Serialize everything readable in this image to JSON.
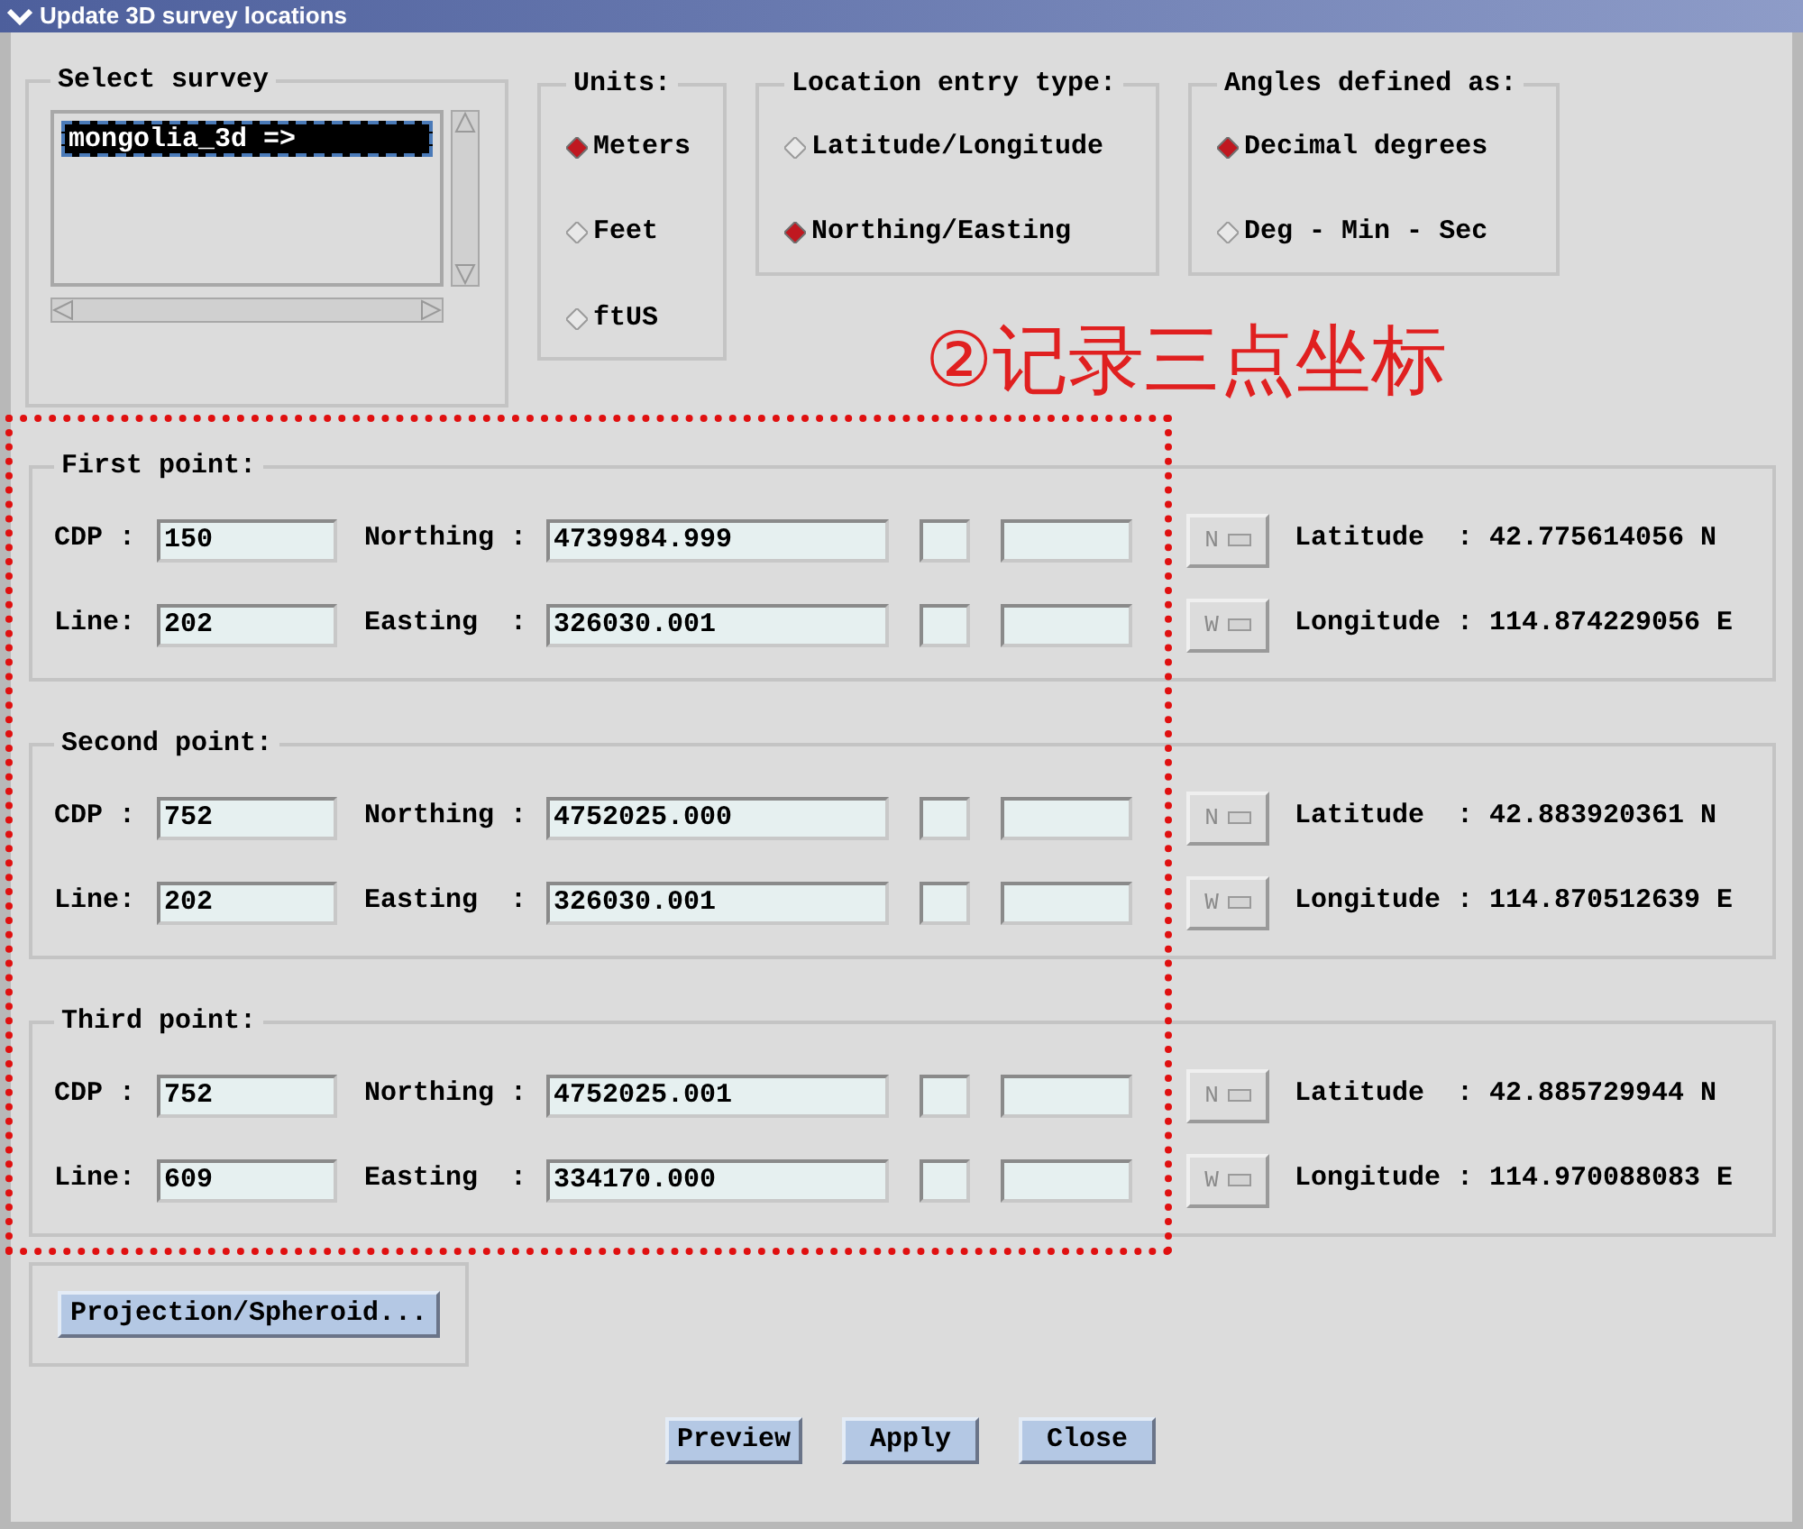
{
  "window": {
    "title": "Update 3D survey locations"
  },
  "survey": {
    "title": "Select survey",
    "items": [
      {
        "label": "mongolia_3d =>",
        "selected": true
      }
    ]
  },
  "radio_groups": [
    {
      "title": "Units:",
      "options": [
        {
          "label": "Meters",
          "selected": true
        },
        {
          "label": "Feet",
          "selected": false
        },
        {
          "label": "ftUS",
          "selected": false
        }
      ]
    },
    {
      "title": "Location entry type:",
      "options": [
        {
          "label": "Latitude/Longitude",
          "selected": false
        },
        {
          "label": "Northing/Easting",
          "selected": true
        }
      ]
    },
    {
      "title": "Angles defined as:",
      "options": [
        {
          "label": "Decimal degrees",
          "selected": true
        },
        {
          "label": "Deg - Min - Sec",
          "selected": false
        }
      ]
    }
  ],
  "annotation": {
    "text": "②记录三点坐标"
  },
  "points": [
    {
      "title": "First point:",
      "rows": [
        {
          "label": "CDP :",
          "value": "150",
          "coord_label": "Northing :",
          "coord_value": "4739984.999",
          "toggle": "N",
          "result_label": "Latitude  :",
          "result_value": "42.775614056 N"
        },
        {
          "label": "Line:",
          "value": "202",
          "coord_label": "Easting  :",
          "coord_value": "326030.001",
          "toggle": "W",
          "result_label": "Longitude :",
          "result_value": "114.874229056 E"
        }
      ]
    },
    {
      "title": "Second point:",
      "rows": [
        {
          "label": "CDP :",
          "value": "752",
          "coord_label": "Northing :",
          "coord_value": "4752025.000",
          "toggle": "N",
          "result_label": "Latitude  :",
          "result_value": "42.883920361 N"
        },
        {
          "label": "Line:",
          "value": "202",
          "coord_label": "Easting  :",
          "coord_value": "326030.001",
          "toggle": "W",
          "result_label": "Longitude :",
          "result_value": "114.870512639 E"
        }
      ]
    },
    {
      "title": "Third point:",
      "rows": [
        {
          "label": "CDP :",
          "value": "752",
          "coord_label": "Northing :",
          "coord_value": "4752025.001",
          "toggle": "N",
          "result_label": "Latitude  :",
          "result_value": "42.885729944 N"
        },
        {
          "label": "Line:",
          "value": "609",
          "coord_label": "Easting  :",
          "coord_value": "334170.000",
          "toggle": "W",
          "result_label": "Longitude :",
          "result_value": "114.970088083 E"
        }
      ]
    }
  ],
  "projection_button": "Projection/Spheroid...",
  "buttons": [
    "Preview",
    "Apply",
    "Close"
  ]
}
